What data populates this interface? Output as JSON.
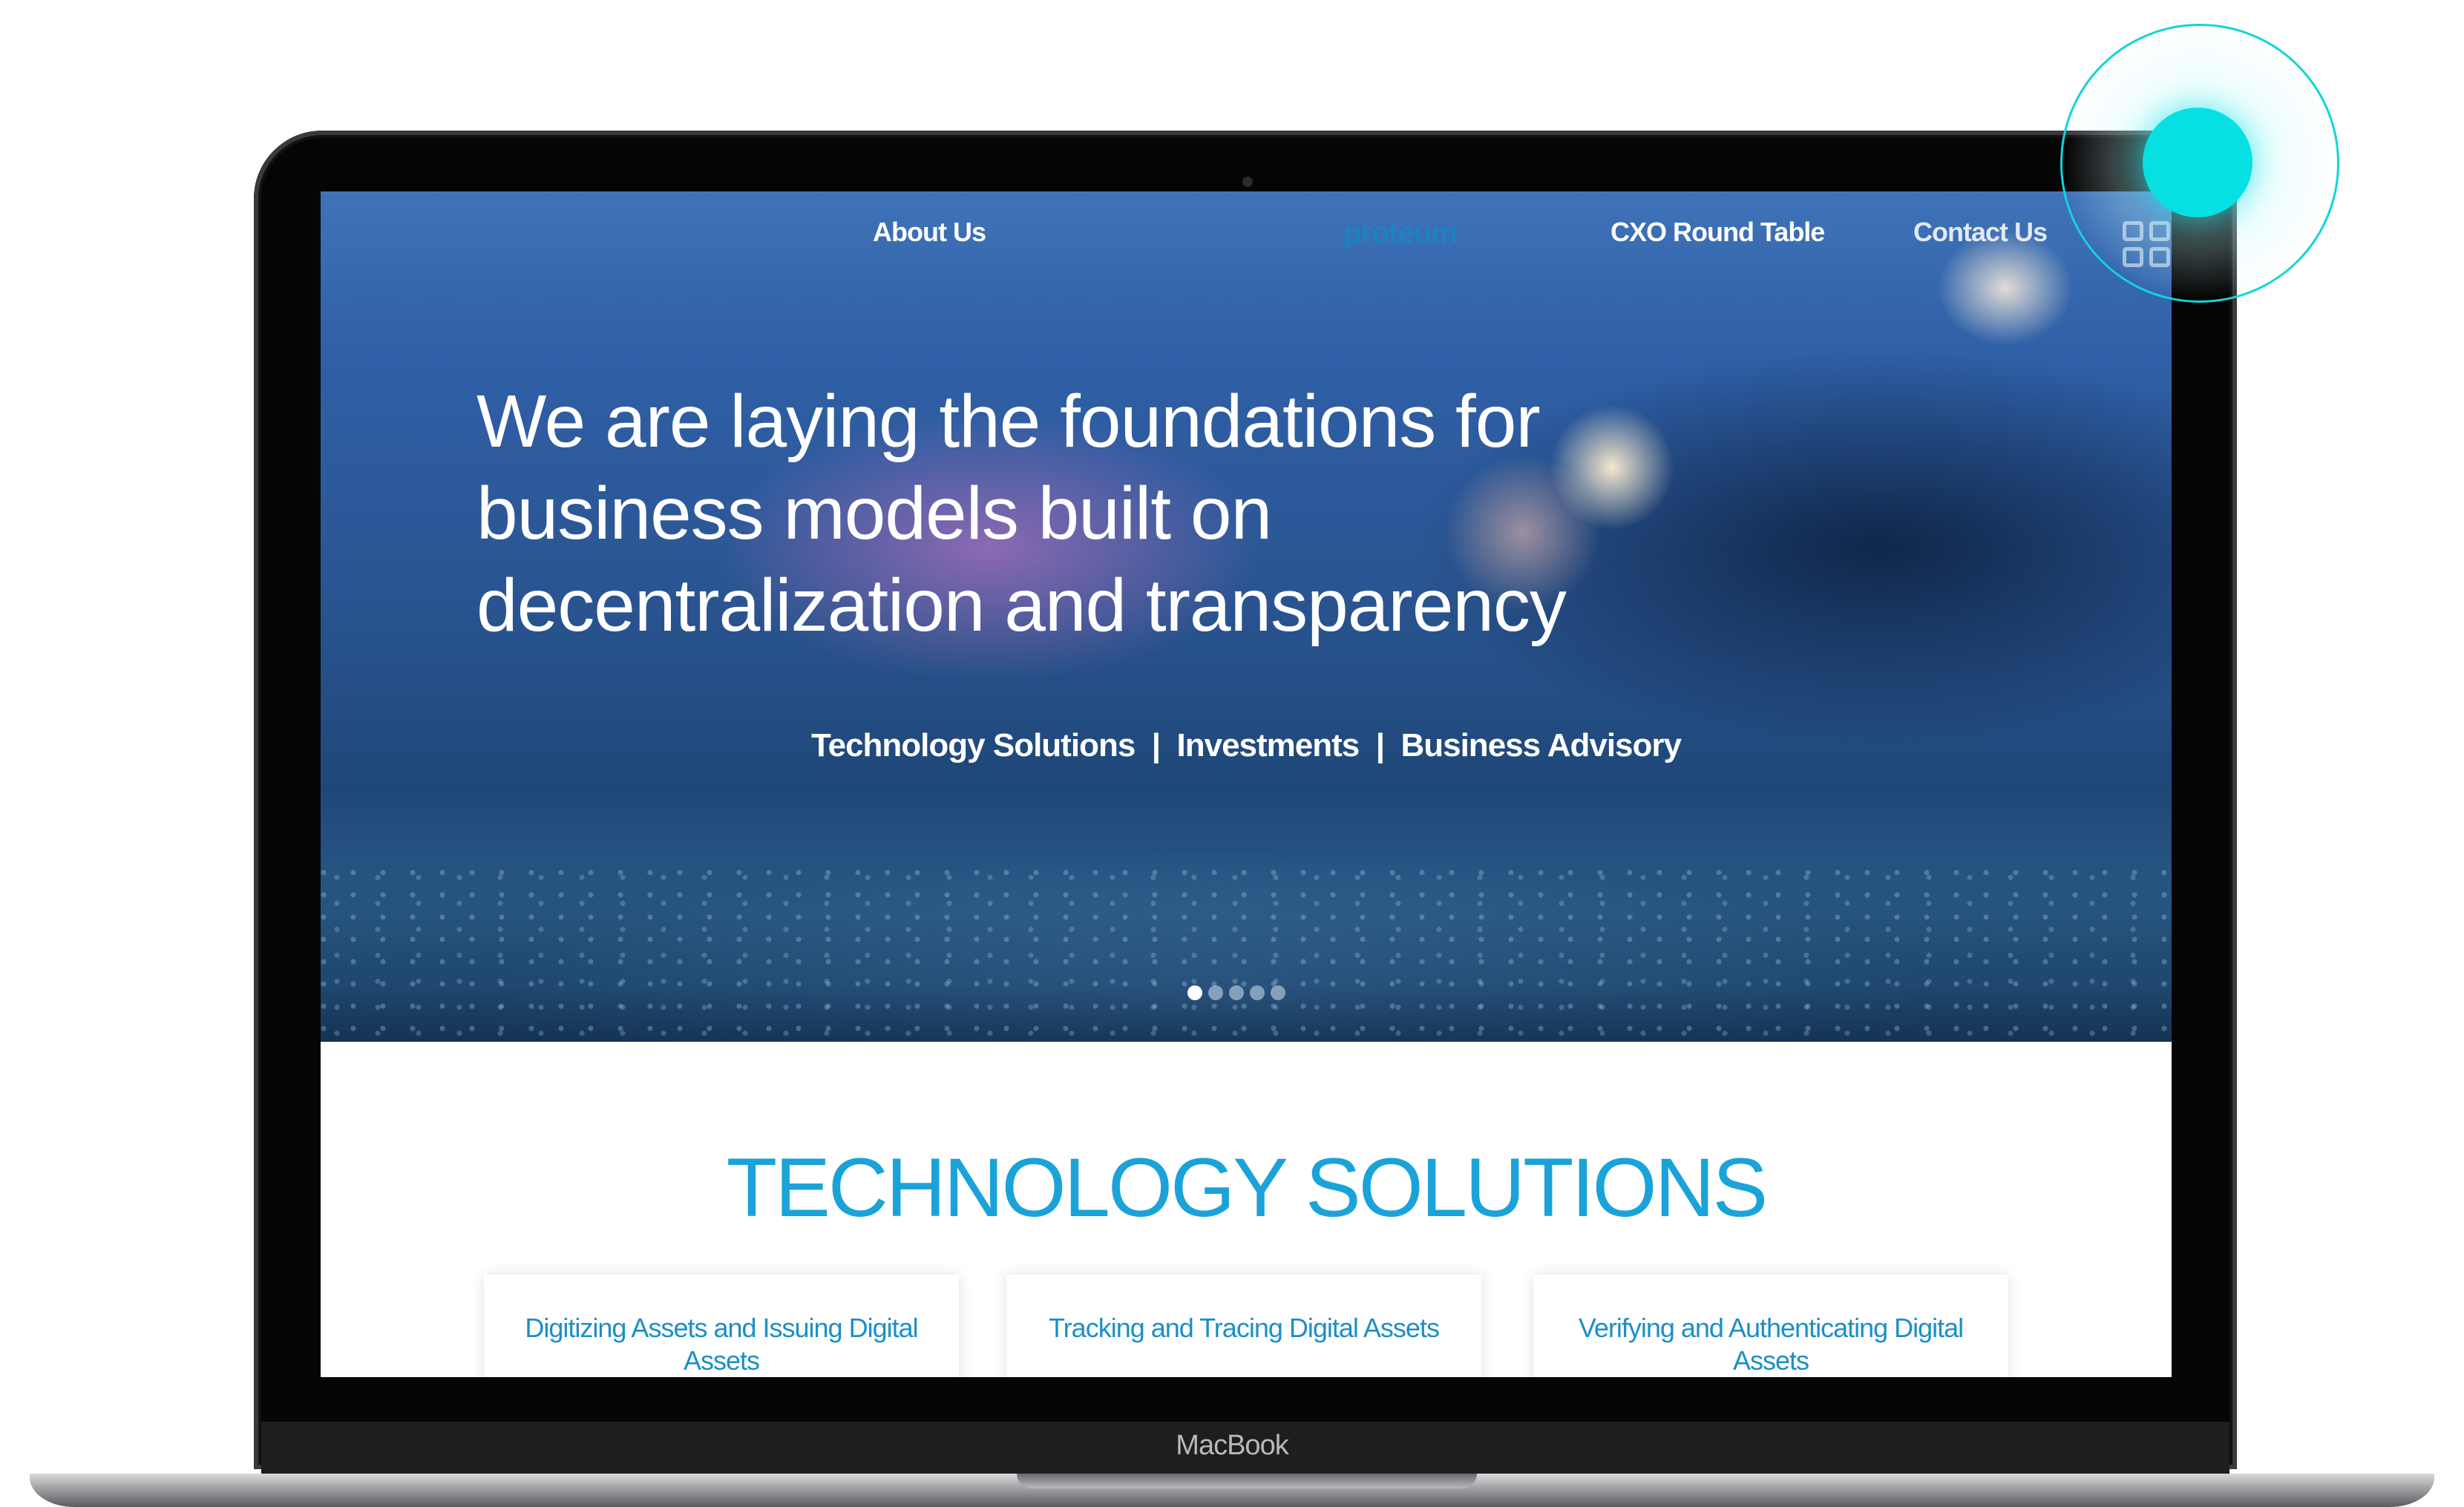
{
  "device": {
    "label": "MacBook"
  },
  "nav": {
    "about": "About Us",
    "logo": "proteum",
    "cxo": "CXO Round Table",
    "contact": "Contact Us"
  },
  "hero": {
    "title_line1": "We are laying the foundations for",
    "title_line2": "business models built on",
    "title_line3": "decentralization and transparency",
    "subtitle": "Technology Solutions  |  Investments  |  Business Advisory",
    "slide_count": 5,
    "active_slide": 1
  },
  "section": {
    "title": "TECHNOLOGY SOLUTIONS",
    "cards": [
      {
        "label": "Digitizing Assets and Issuing Digital Assets"
      },
      {
        "label": "Tracking and Tracing Digital Assets"
      },
      {
        "label": "Verifying and Authenticating Digital Assets"
      }
    ]
  },
  "colors": {
    "accent": "#1aa3d9",
    "touch": "#06e0e3"
  }
}
